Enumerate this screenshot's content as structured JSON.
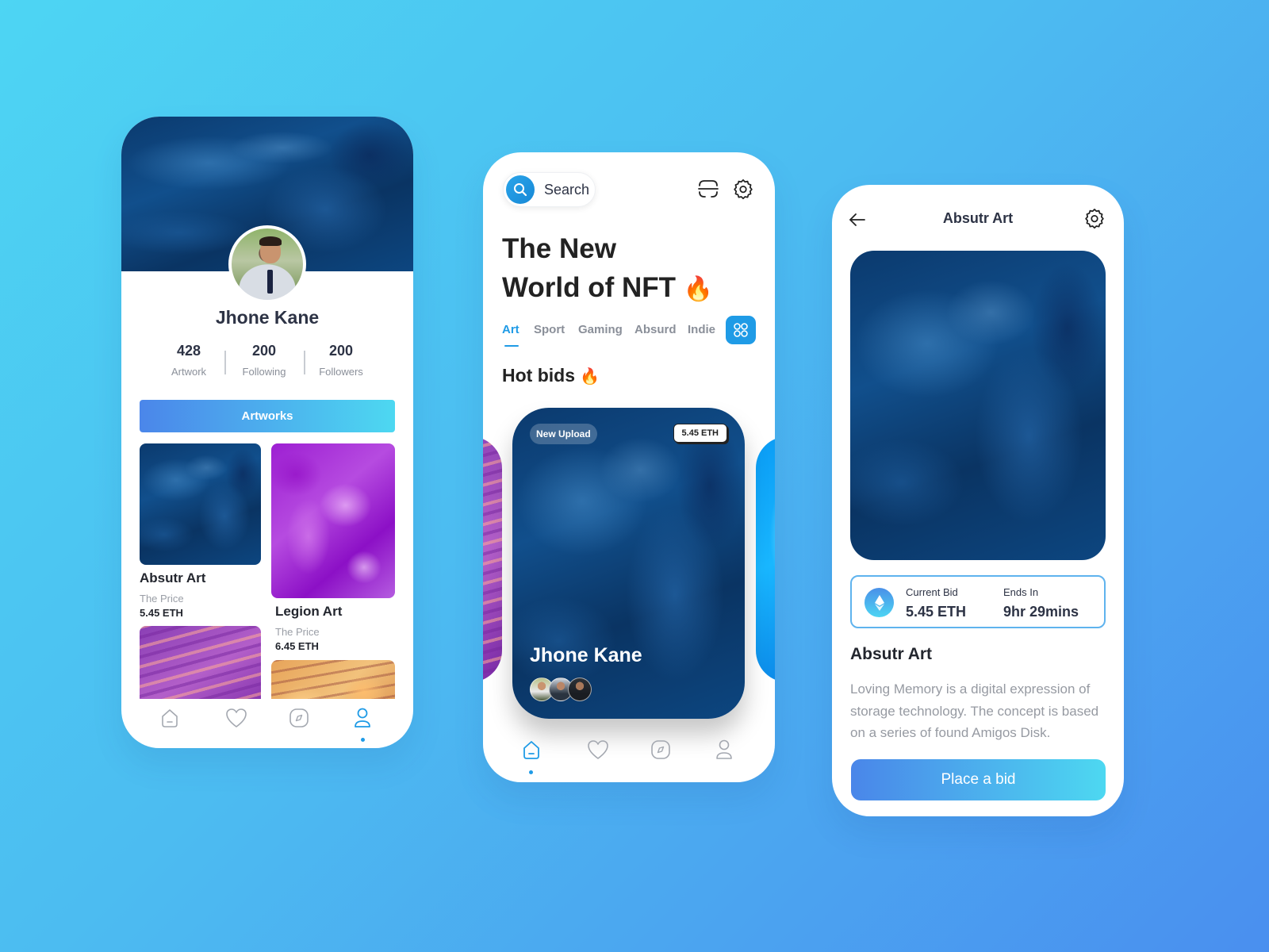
{
  "colors": {
    "accent": "#1f9be6",
    "gradient_start": "#4b86ea",
    "gradient_end": "#4dd8f1",
    "text_dark": "#2d3345",
    "text_muted": "#8a8f99"
  },
  "profile_screen": {
    "user_name": "Jhone Kane",
    "stats": [
      {
        "value": "428",
        "label": "Artwork"
      },
      {
        "value": "200",
        "label": "Following"
      },
      {
        "value": "200",
        "label": "Followers"
      }
    ],
    "artworks_button": "Artworks",
    "artworks": [
      {
        "title": "Absutr Art",
        "price_label": "The Price",
        "price": "5.45 ETH"
      },
      {
        "title": "Legion Art",
        "price_label": "The Price",
        "price": "6.45 ETH"
      }
    ],
    "bottom_nav": [
      {
        "icon": "home-icon",
        "active": false
      },
      {
        "icon": "heart-icon",
        "active": false
      },
      {
        "icon": "compass-icon",
        "active": false
      },
      {
        "icon": "user-icon",
        "active": true
      }
    ]
  },
  "home_screen": {
    "search_label": "Search",
    "headline_line1": "The New",
    "headline_line2": "World of NFT",
    "headline_emoji": "🔥",
    "tabs": [
      {
        "label": "Art",
        "active": true
      },
      {
        "label": "Sport",
        "active": false
      },
      {
        "label": "Gaming",
        "active": false
      },
      {
        "label": "Absurd",
        "active": false
      },
      {
        "label": "Indie",
        "active": false
      }
    ],
    "section_title": "Hot bids",
    "section_emoji": "🔥",
    "hot_card": {
      "badge": "New Upload",
      "price": "5.45 ETH",
      "owner": "Jhone Kane"
    },
    "bottom_nav": [
      {
        "icon": "home-icon",
        "active": true
      },
      {
        "icon": "heart-icon",
        "active": false
      },
      {
        "icon": "compass-icon",
        "active": false
      },
      {
        "icon": "user-icon",
        "active": false
      }
    ]
  },
  "detail_screen": {
    "header_title": "Absutr Art",
    "current_bid_label": "Current Bid",
    "current_bid_value": "5.45 ETH",
    "ends_in_label": "Ends In",
    "ends_in_value": "9hr 29mins",
    "art_title": "Absutr Art",
    "description": "Loving Memory is a digital expression of storage technology. The concept is based on a series of found Amigos Disk.",
    "bid_button": "Place a bid"
  }
}
